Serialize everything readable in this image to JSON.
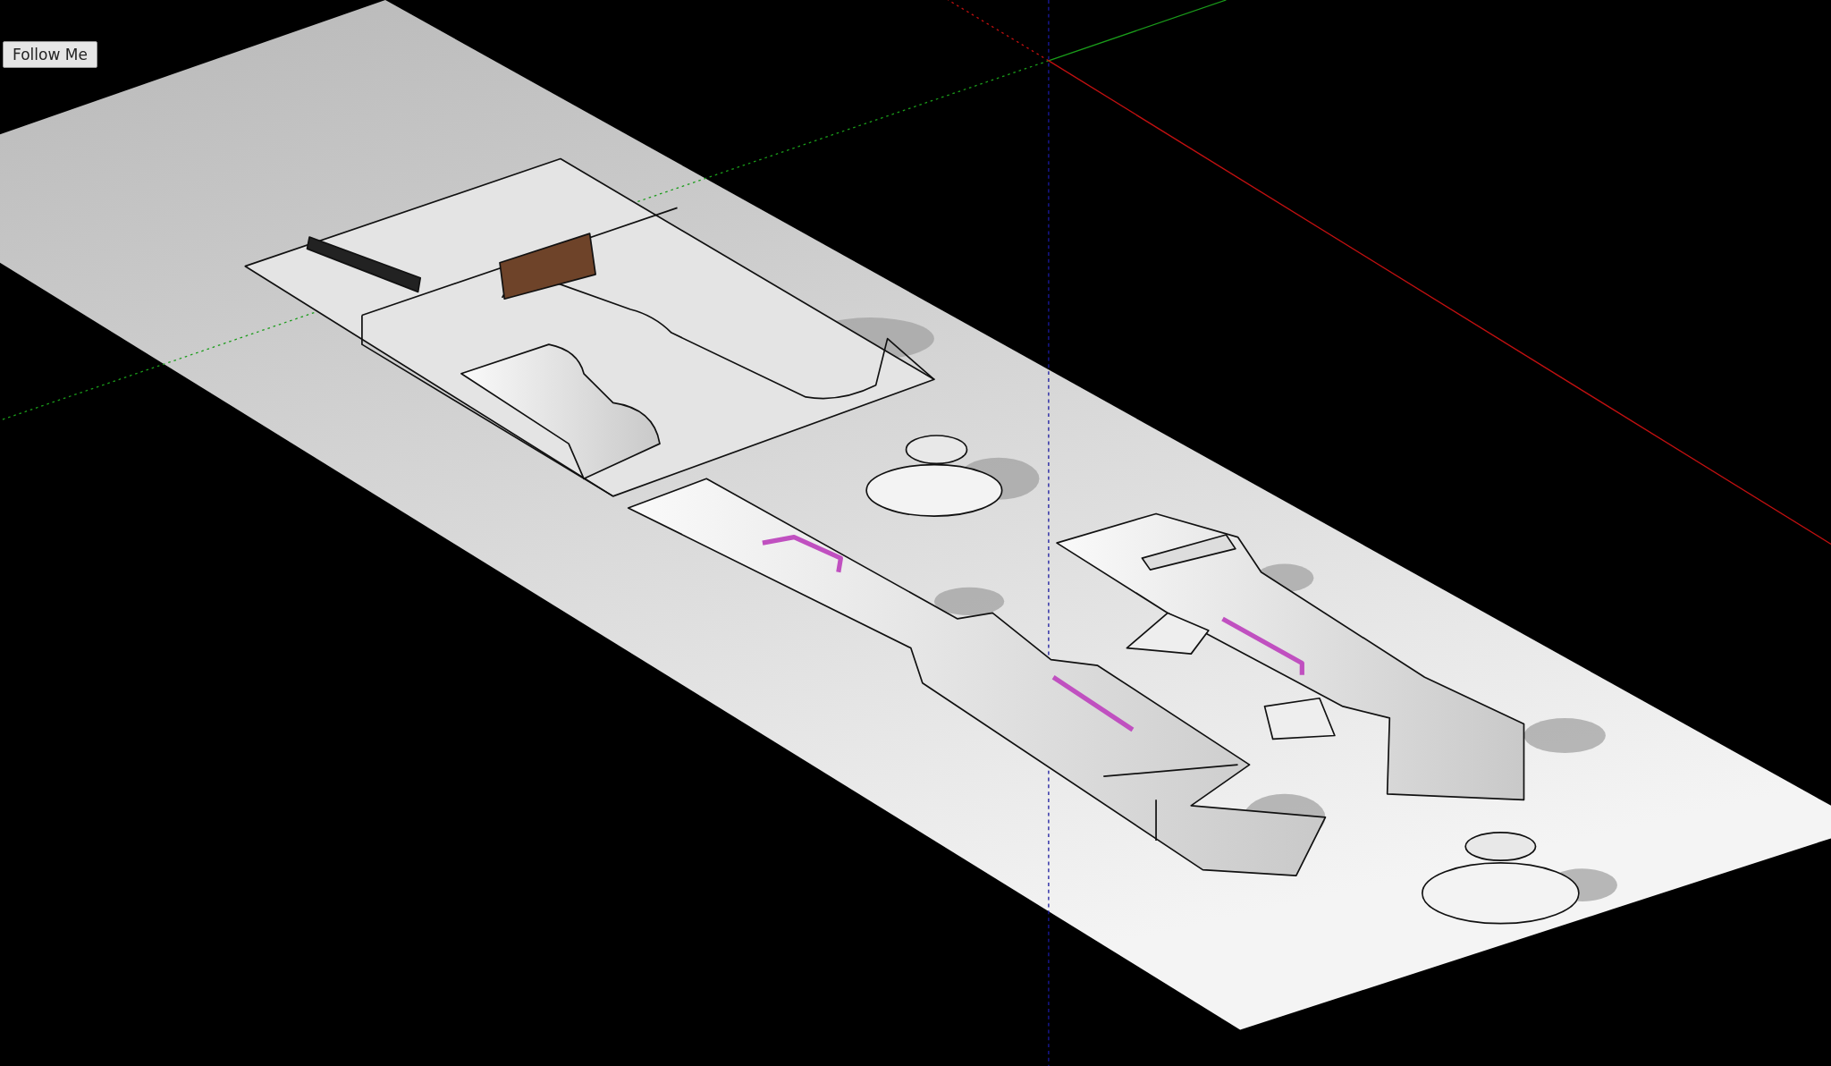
{
  "tool_hint": {
    "label": "Follow Me"
  }
}
